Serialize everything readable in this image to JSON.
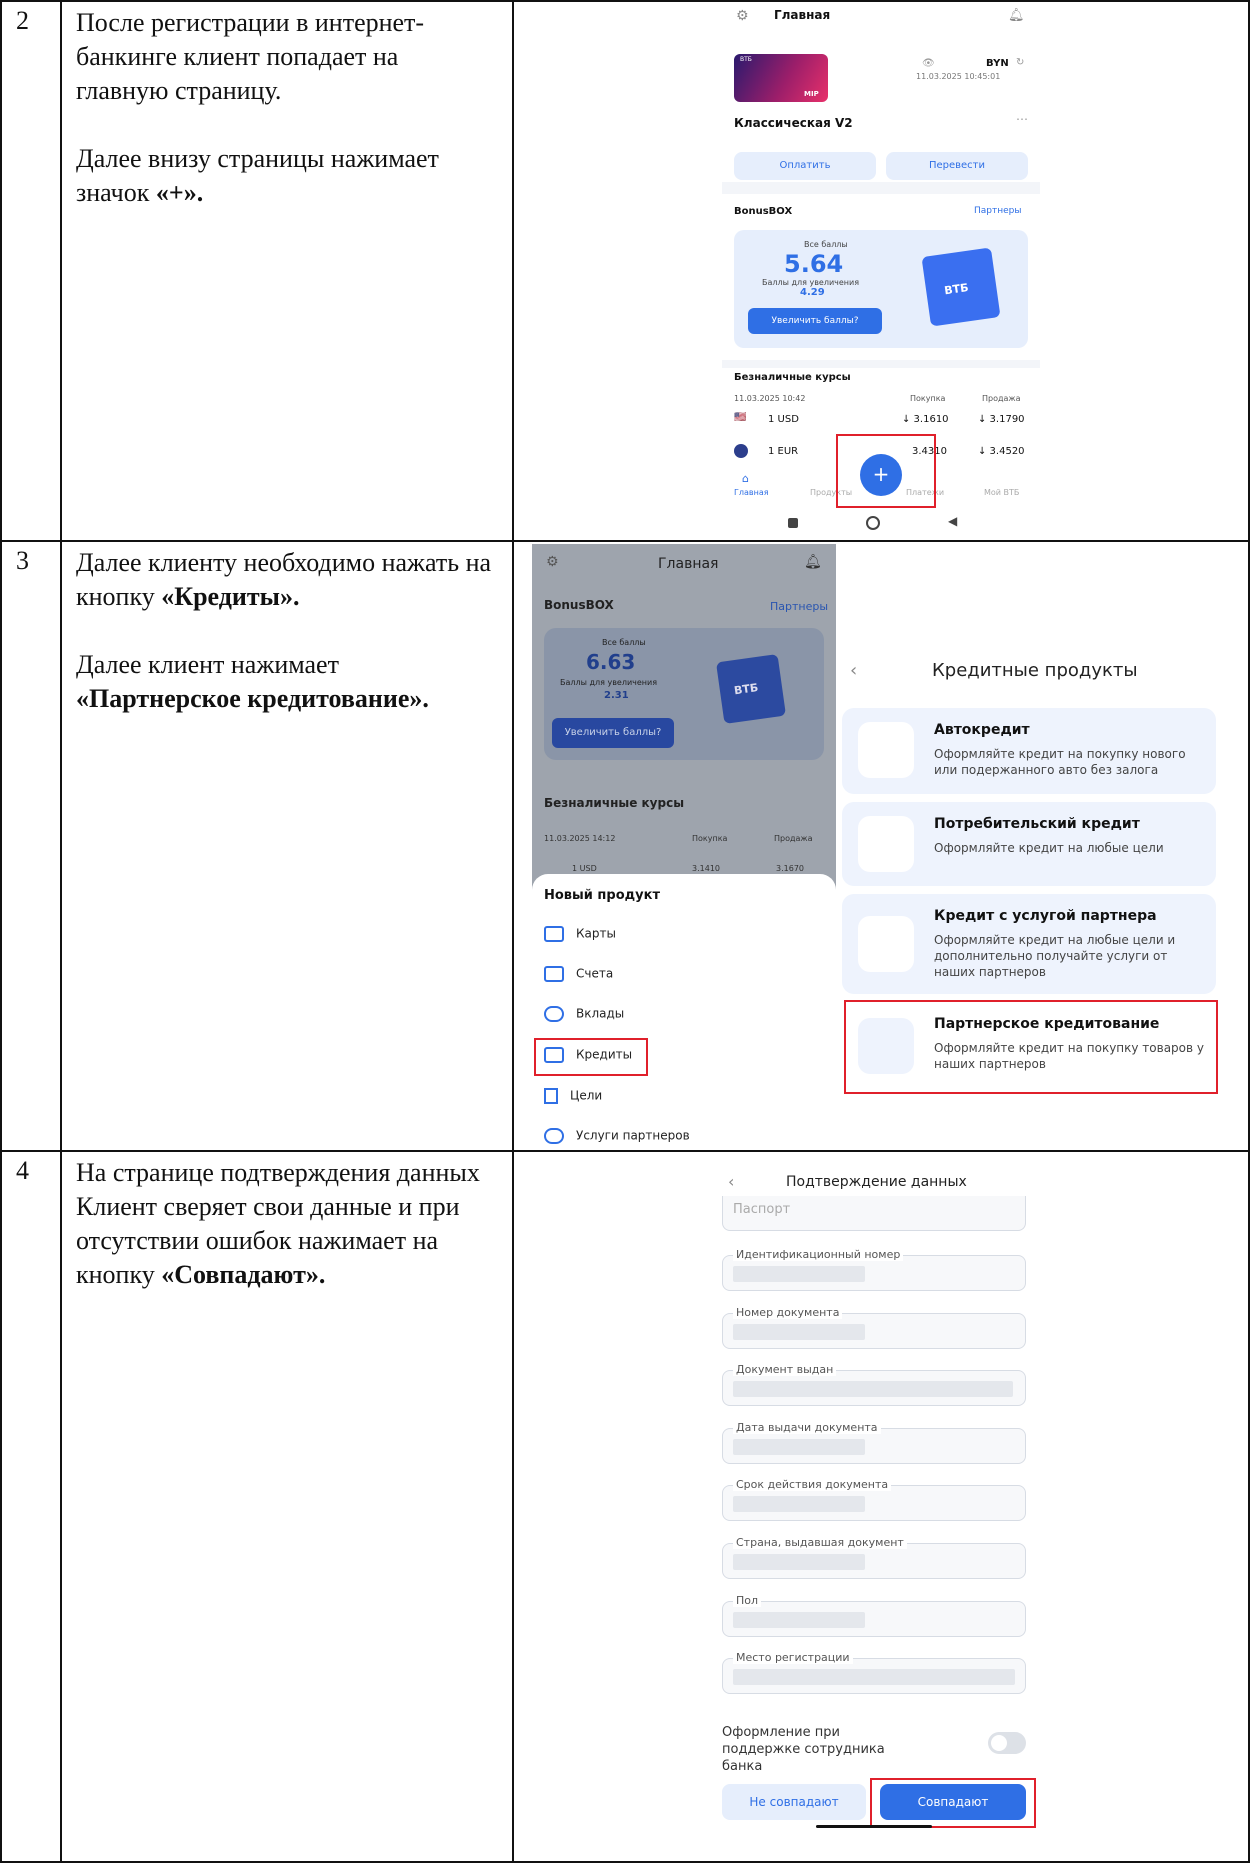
{
  "rows": [
    {
      "number": "2",
      "paragraphs": [
        {
          "text": "После регистрации в интернет-банкинге клиент попадает на главную страницу.",
          "bold": ""
        },
        {
          "text": "Далее внизу страницы нажимает значок ",
          "bold": "«+»."
        }
      ]
    },
    {
      "number": "3",
      "paragraphs": [
        {
          "text": "Далее клиенту необходимо нажать на кнопку ",
          "bold": "«Кредиты»."
        },
        {
          "text": "Далее клиент нажимает ",
          "bold": "«Партнерское кредитование»."
        }
      ]
    },
    {
      "number": "4",
      "paragraphs": [
        {
          "text": "На странице подтверждения данных Клиент сверяет свои данные и при отсутствии ошибок нажимает на кнопку ",
          "bold": "«Совпадают»."
        }
      ]
    }
  ],
  "screen1": {
    "header_title": "Главная",
    "card_name": "Классическая V2",
    "currency": "BYN",
    "timestamp": "11.03.2025 10:45:01",
    "card_brand": "МІР",
    "card_bank": "ВТБ",
    "pay_button": "Оплатить",
    "transfer_button": "Перевести",
    "bonus_title": "BonusBOX",
    "partners_link": "Партнеры",
    "all_points_label": "Все баллы",
    "all_points_value": "5.64",
    "increase_label": "Баллы для увеличения",
    "increase_value": "4.29",
    "increase_button": "Увеличить баллы?",
    "box_label": "ВТБ",
    "rates_title": "Безналичные курсы",
    "rates_date": "11.03.2025 10:42",
    "buy_header": "Покупка",
    "sell_header": "Продажа",
    "rates": [
      {
        "currency": "1 USD",
        "buy": "↓ 3.1610",
        "sell": "↓ 3.1790"
      },
      {
        "currency": "1 EUR",
        "buy": "3.4310",
        "sell": "↓ 3.4520"
      }
    ],
    "plus_label": "+",
    "nav": [
      "Главная",
      "Продукты",
      "Платежи",
      "Мой ВТБ"
    ]
  },
  "screen2": {
    "header_title": "Главная",
    "bonus_title": "BonusBOX",
    "partners_link": "Партнеры",
    "all_points_label": "Все баллы",
    "all_points_value": "6.63",
    "increase_label": "Баллы для увеличения",
    "increase_value": "2.31",
    "increase_button": "Увеличить баллы?",
    "box_label": "ВТБ",
    "rates_title": "Безналичные курсы",
    "rates_date": "11.03.2025 14:12",
    "buy_header": "Покупка",
    "sell_header": "Продажа",
    "rate_currency": "1 USD",
    "rate_buy": "3.1410",
    "rate_sell": "3.1670",
    "new_product_title": "Новый продукт",
    "menu": [
      "Карты",
      "Счета",
      "Вклады",
      "Кредиты",
      "Цели",
      "Услуги партнеров"
    ]
  },
  "screen3": {
    "title": "Кредитные продукты",
    "items": [
      {
        "title": "Автокредит",
        "desc": "Оформляйте кредит на покупку нового или подержанного авто без залога"
      },
      {
        "title": "Потребительский кредит",
        "desc": "Оформляйте кредит на любые цели"
      },
      {
        "title": "Кредит с услугой партнера",
        "desc": "Оформляйте кредит на любые цели и дополнительно получайте услуги от наших партнеров"
      },
      {
        "title": "Партнерское кредитование",
        "desc": "Оформляйте кредит на покупку товаров у наших партнеров"
      }
    ]
  },
  "screen4": {
    "title": "Подтверждение данных",
    "passport_label": "Паспорт",
    "fields": [
      "Идентификационный номер",
      "Номер документа",
      "Документ выдан",
      "Дата выдачи документа",
      "Срок действия документа",
      "Страна, выдавшая документ",
      "Пол",
      "Место регистрации"
    ],
    "support_text": "Оформление при поддержке сотрудника банка",
    "mismatch_button": "Не совпадают",
    "match_button": "Совпадают"
  },
  "colors": {
    "accent": "#2f6fe5",
    "highlight": "#e0202b",
    "panel": "#eef3fd"
  }
}
